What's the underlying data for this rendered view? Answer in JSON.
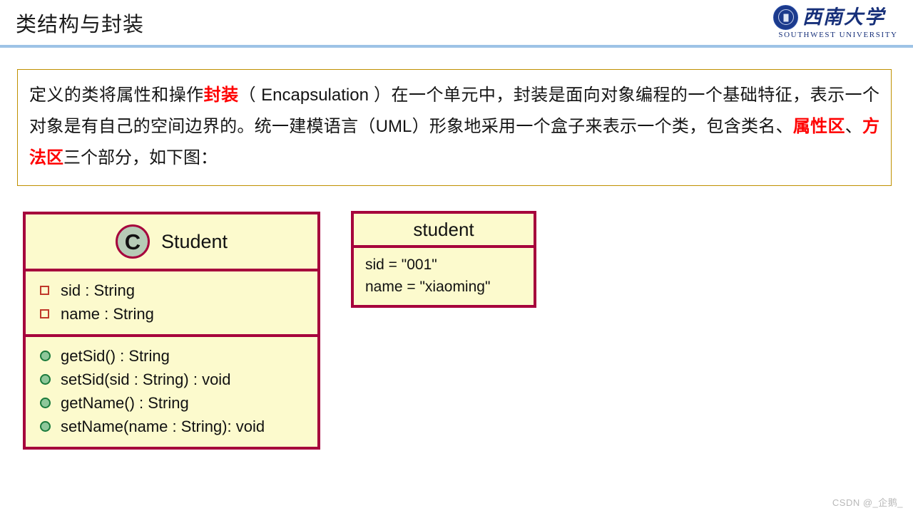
{
  "header": {
    "title": "类结构与封装",
    "rule_color": "#9dc3e6",
    "logo": {
      "seal_icon": "university-seal-icon",
      "name_cn": "西南大学",
      "name_en": "SOUTHWEST UNIVERSITY"
    }
  },
  "description": {
    "border_color": "#bf9000",
    "highlight_color": "#ff0000",
    "segments": [
      {
        "text": "定义的类将属性和操作",
        "highlight": false
      },
      {
        "text": "封装",
        "highlight": true
      },
      {
        "text": "（ Encapsulation ）在一个单元中，封装是面向对象编程的一个基础特征，表示一个对象是有自己的空间边界的。统一建模语言（UML）形象地采用一个盒子来表示一个类，包含类名、",
        "highlight": false
      },
      {
        "text": "属性区",
        "highlight": true
      },
      {
        "text": "、",
        "highlight": false
      },
      {
        "text": "方法区",
        "highlight": true
      },
      {
        "text": "三个部分，如下图：",
        "highlight": false
      }
    ]
  },
  "uml_class": {
    "border_color": "#a6023c",
    "fill_color": "#fcfacd",
    "stereotype_badge": "C",
    "class_name": "Student",
    "attributes": [
      {
        "marker": "attribute-square-icon",
        "label": "sid : String"
      },
      {
        "marker": "attribute-square-icon",
        "label": "name : String"
      }
    ],
    "methods": [
      {
        "marker": "method-circle-icon",
        "label": "getSid() : String"
      },
      {
        "marker": "method-circle-icon",
        "label": "setSid(sid : String) : void"
      },
      {
        "marker": "method-circle-icon",
        "label": "getName() : String"
      },
      {
        "marker": "method-circle-icon",
        "label": "setName(name : String): void"
      }
    ]
  },
  "uml_object": {
    "border_color": "#a6023c",
    "fill_color": "#fcfacd",
    "object_name": "student",
    "fields": [
      "sid = \"001\"",
      "name = \"xiaoming\""
    ]
  },
  "watermark": {
    "text": "CSDN @_企鹅_"
  }
}
